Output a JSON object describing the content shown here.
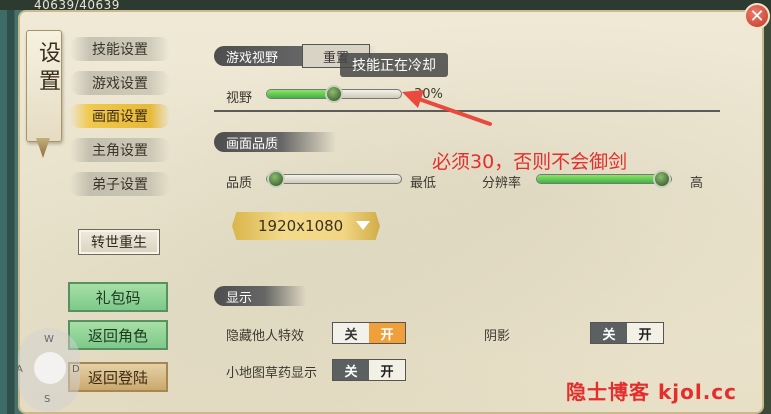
{
  "top_bar": {
    "hp": "40639/40639"
  },
  "title": "设置",
  "nav": {
    "items": [
      {
        "label": "技能设置",
        "active": false
      },
      {
        "label": "游戏设置",
        "active": false
      },
      {
        "label": "画面设置",
        "active": true
      },
      {
        "label": "主角设置",
        "active": false
      },
      {
        "label": "弟子设置",
        "active": false
      }
    ],
    "rebirth": "转世重生",
    "gift_code": "礼包码",
    "back_role": "返回角色",
    "back_login": "返回登陆"
  },
  "joystick": {
    "up": "W",
    "left": "A",
    "right": "D",
    "down": "S"
  },
  "view": {
    "section": "游戏视野",
    "reset": "重置",
    "toast": "技能正在冷却",
    "label": "视野",
    "value_text": "30%",
    "value": 0.3
  },
  "quality": {
    "section": "画面品质",
    "label": "品质",
    "min_label": "最低",
    "quality_value": 0.0,
    "resolution_label": "分辨率",
    "resolution_max": "高",
    "resolution_value": 1.0,
    "resolution_select": "1920x1080"
  },
  "display": {
    "section": "显示",
    "hide_effects": {
      "label": "隐藏他人特效",
      "off": "关",
      "on": "开",
      "state": "on"
    },
    "shadow": {
      "label": "阴影",
      "off": "关",
      "on": "开",
      "state": "off"
    },
    "minimap_herb": {
      "label": "小地图草药显示",
      "off": "关",
      "on": "开",
      "state": "off"
    }
  },
  "annotation": "必须30，否则不会御剑",
  "watermark": "隐士博客 kjol.cc",
  "colors": {
    "annotation": "#e52d2d",
    "slider_fill": "#3fb43f",
    "active_nav": "#f0c84a"
  }
}
